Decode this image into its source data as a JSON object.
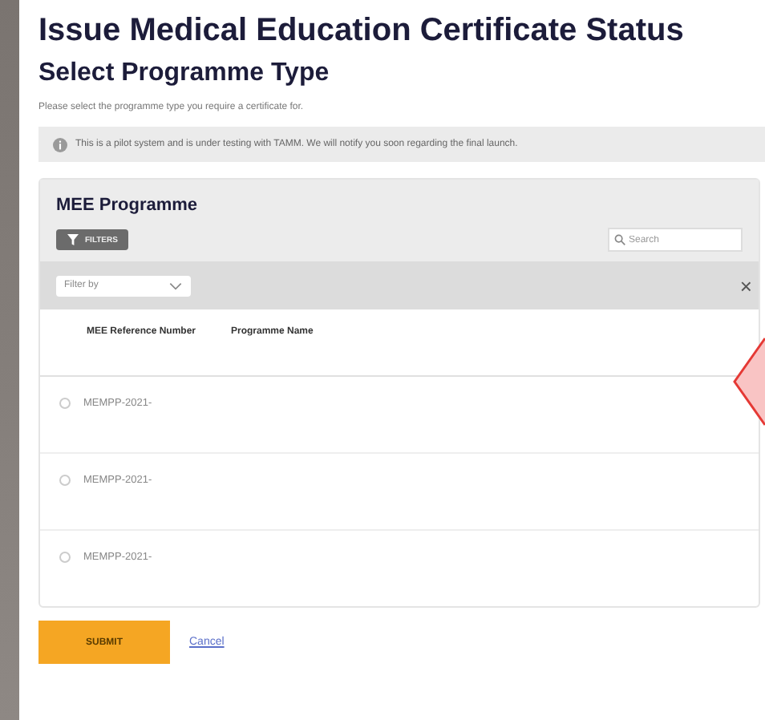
{
  "page": {
    "title": "Issue Medical Education Certificate Status",
    "subtitle": "Select Programme Type",
    "instruction": "Please select the programme type you require a certificate for.",
    "notice": "This is a pilot system and is under testing with TAMM. We will notify you soon regarding the final launch."
  },
  "card": {
    "title": "MEE Programme",
    "filters_button": "FILTERS",
    "search": {
      "placeholder": "Search"
    },
    "filter_select": {
      "placeholder": "Filter by"
    },
    "clear_icon": "×"
  },
  "table": {
    "columns": [
      "MEE Reference Number",
      "Programme Name"
    ],
    "rows": [
      {
        "reference": "MEMPP-2021-",
        "selected": false
      },
      {
        "reference": "MEMPP-2021-",
        "selected": false
      },
      {
        "reference": "MEMPP-2021-",
        "selected": false
      }
    ]
  },
  "buttons": {
    "submit": "SUBMIT",
    "cancel": "Cancel"
  }
}
